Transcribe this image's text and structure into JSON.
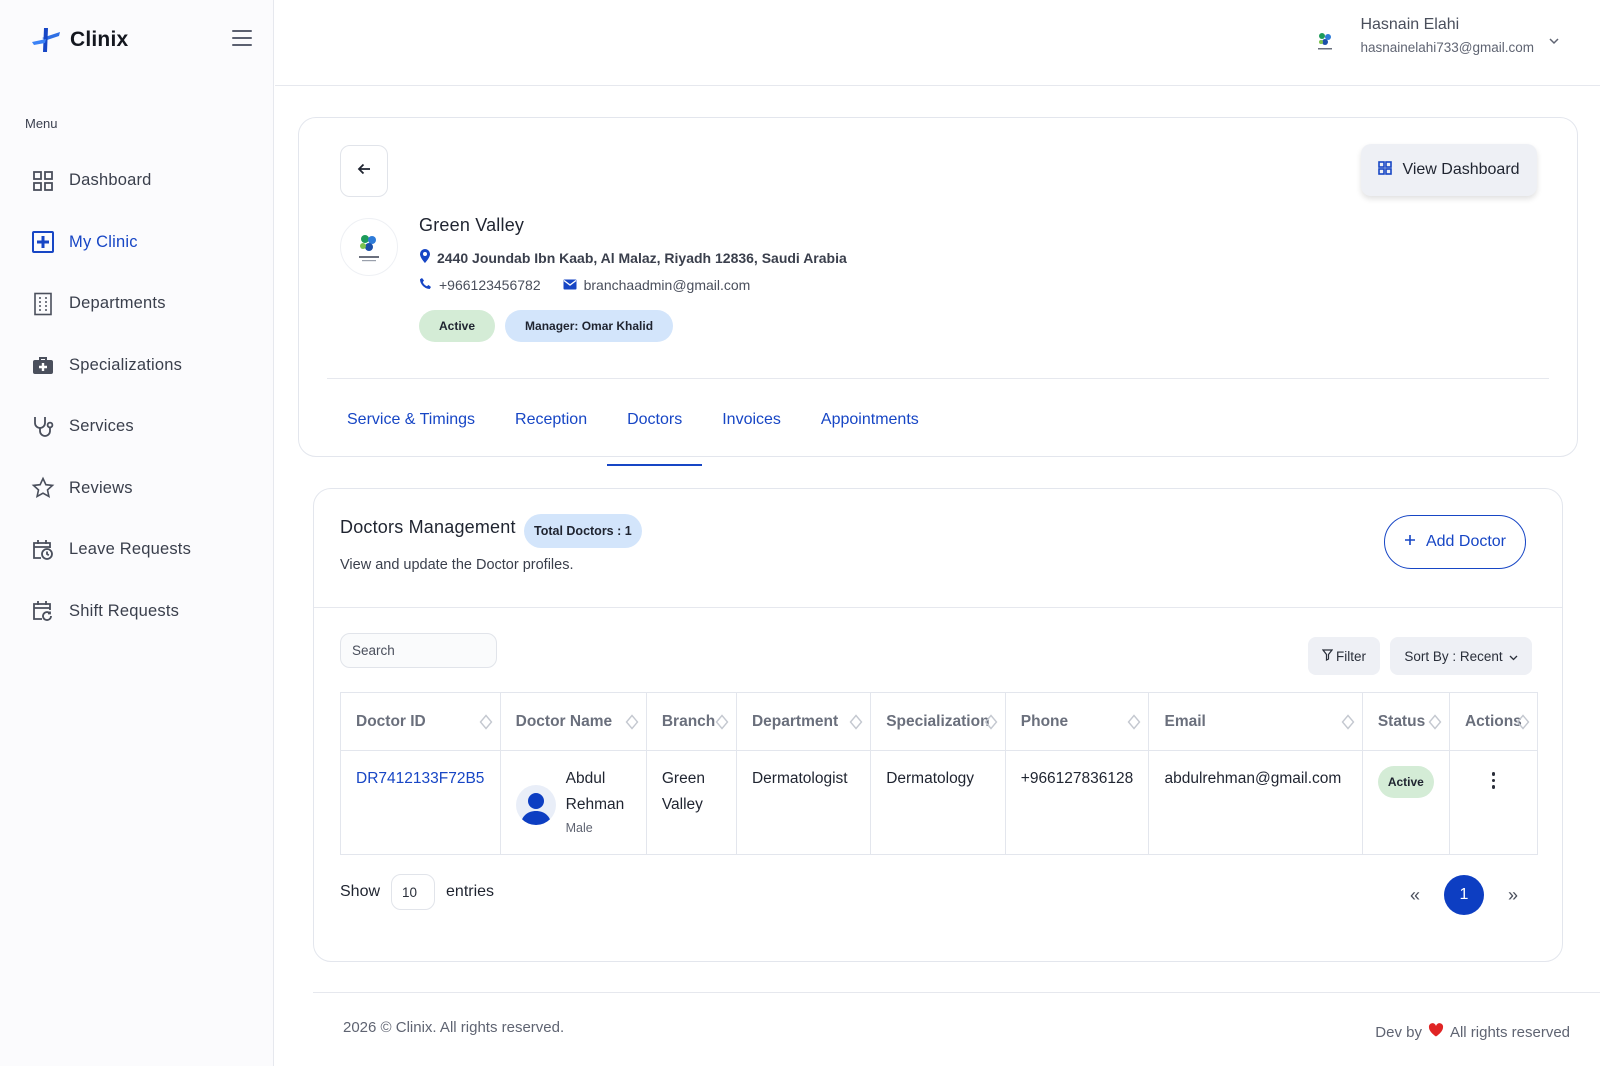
{
  "brand": {
    "name": "Clinix"
  },
  "sidebar": {
    "menu_label": "Menu",
    "items": [
      {
        "label": "Dashboard",
        "icon": "grid-icon",
        "active": false
      },
      {
        "label": "My Clinic",
        "icon": "plus-square-icon",
        "active": true
      },
      {
        "label": "Departments",
        "icon": "building-icon",
        "active": false
      },
      {
        "label": "Specializations",
        "icon": "medkit-icon",
        "active": false
      },
      {
        "label": "Services",
        "icon": "stethoscope-icon",
        "active": false
      },
      {
        "label": "Reviews",
        "icon": "star-icon",
        "active": false
      },
      {
        "label": "Leave Requests",
        "icon": "calendar-clock-icon",
        "active": false
      },
      {
        "label": "Shift Requests",
        "icon": "calendar-refresh-icon",
        "active": false
      }
    ]
  },
  "header": {
    "user_name": "Hasnain Elahi",
    "user_email": "hasnainelahi733@gmail.com"
  },
  "clinic": {
    "view_dashboard_label": "View Dashboard",
    "name": "Green Valley",
    "address": "2440 Joundab Ibn Kaab, Al Malaz, Riyadh 12836, Saudi Arabia",
    "phone": "+966123456782",
    "email": "branchaadmin@gmail.com",
    "status": "Active",
    "manager": "Manager: Omar Khalid",
    "tabs": [
      {
        "label": "Service & Timings",
        "active": false
      },
      {
        "label": "Reception",
        "active": false
      },
      {
        "label": "Doctors",
        "active": true
      },
      {
        "label": "Invoices",
        "active": false
      },
      {
        "label": "Appointments",
        "active": false
      }
    ]
  },
  "doctors": {
    "title": "Doctors Management",
    "total_label": "Total Doctors : 1",
    "subtitle": "View and update the Doctor profiles.",
    "add_label": "Add Doctor",
    "search_placeholder": "Search",
    "filter_label": "Filter",
    "sort_label": "Sort By : Recent",
    "columns": [
      "Doctor ID",
      "Doctor Name",
      "Branch",
      "Department",
      "Specialization",
      "Phone",
      "Email",
      "Status",
      "Actions"
    ],
    "rows": [
      {
        "id": "DR7412133F72B5",
        "first_name": "Abdul",
        "last_name": "Rehman",
        "gender": "Male",
        "branch_1": "Green",
        "branch_2": "Valley",
        "department": "Dermatologist",
        "specialization": "Dermatology",
        "phone": "+966127836128",
        "email": "abdulrehman@gmail.com",
        "status": "Active"
      }
    ],
    "show_label": "Show",
    "entries_value": "10",
    "entries_label": "entries",
    "page_prev": "«",
    "page_current": "1",
    "page_next": "»"
  },
  "footer": {
    "copyright": "2026 © Clinix. All rights reserved.",
    "dev_by": "Dev by",
    "rights": "All rights reserved"
  },
  "colors": {
    "primary": "#1746c5",
    "active_bg": "#d4ecd6",
    "info_bg": "#d3e5fb"
  }
}
